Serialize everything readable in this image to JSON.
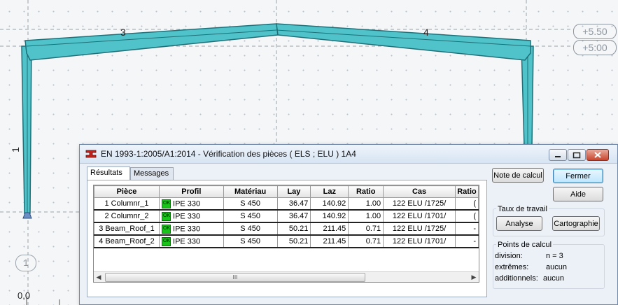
{
  "canvas": {
    "levels": [
      "+5.50",
      "+5:00"
    ],
    "bar_labels": [
      "3",
      "4",
      "1"
    ],
    "node_label": "1",
    "origin_label": "0,0"
  },
  "dialog": {
    "title": "EN 1993-1:2005/A1:2014 - Vérification des pièces ( ELS ; ELU ) 1A4",
    "tabs": [
      "Résultats",
      "Messages"
    ],
    "columns": [
      "Pièce",
      "Profil",
      "Matériau",
      "Lay",
      "Laz",
      "Ratio",
      "Cas",
      "Ratio"
    ],
    "rows": [
      {
        "piece": "1  Columnr_1",
        "status": "OK",
        "profil": "IPE 330",
        "materiau": "S 450",
        "lay": "36.47",
        "laz": "140.92",
        "ratio": "1.00",
        "cas": "122 ELU /1725/",
        "ratio2": "("
      },
      {
        "piece": "2  Columnr_2",
        "status": "OK",
        "profil": "IPE 330",
        "materiau": "S 450",
        "lay": "36.47",
        "laz": "140.92",
        "ratio": "1.00",
        "cas": "122 ELU /1701/",
        "ratio2": "("
      },
      {
        "piece": "3  Beam_Roof_1",
        "status": "OK",
        "profil": "IPE 330",
        "materiau": "S 450",
        "lay": "50.21",
        "laz": "211.45",
        "ratio": "0.71",
        "cas": "122 ELU /1725/",
        "ratio2": "-"
      },
      {
        "piece": "4  Beam_Roof_2",
        "status": "OK",
        "profil": "IPE 330",
        "materiau": "S 450",
        "lay": "50.21",
        "laz": "211.45",
        "ratio": "0.71",
        "cas": "122 ELU /1701/",
        "ratio2": "-"
      }
    ],
    "scroll_thumb": "III",
    "buttons": {
      "note_calcul": "Note de calcul",
      "fermer": "Fermer",
      "aide": "Aide",
      "analyse": "Analyse",
      "cartographie": "Cartographie"
    },
    "taux_label": "Taux de travail",
    "points": {
      "label": "Points de calcul",
      "division_key": "division:",
      "division_value": "n = 3",
      "extremes_key": "extrêmes:",
      "extremes_value": "aucun",
      "additionnels_key": "additionnels:",
      "additionnels_value": "aucun"
    }
  },
  "colors": {
    "member_fill": "#4fc3c9",
    "member_stroke": "#1e6f78",
    "ok_green": "#1cc21c",
    "close_red": "#c8452e"
  }
}
